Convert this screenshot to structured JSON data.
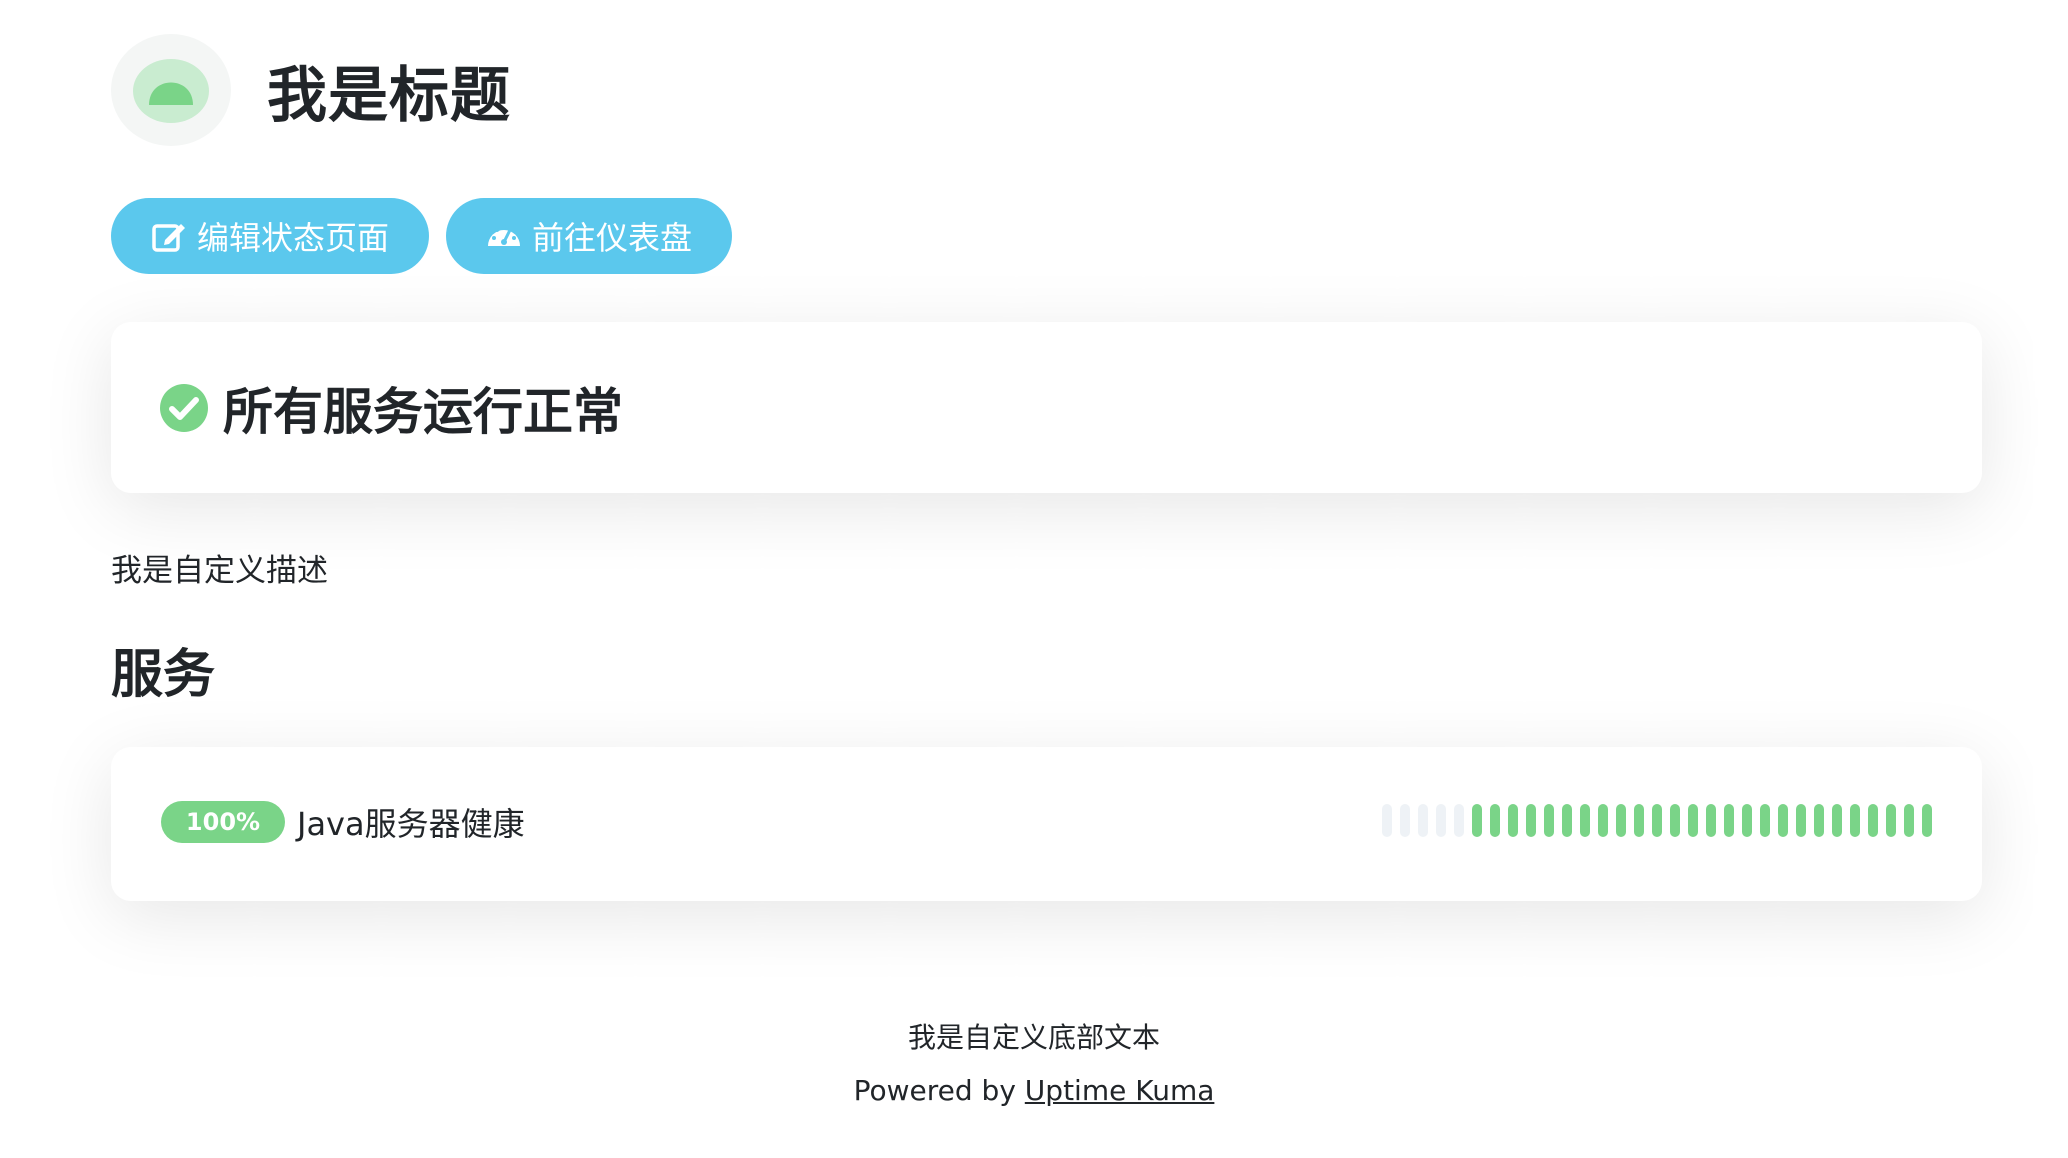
{
  "header": {
    "title": "我是标题",
    "logo_icon": "bulb-logo-icon"
  },
  "actions": {
    "edit_label": "编辑状态页面",
    "edit_icon": "edit-icon",
    "dashboard_label": "前往仪表盘",
    "dashboard_icon": "dashboard-icon"
  },
  "status": {
    "text": "所有服务运行正常",
    "icon": "check-circle-icon"
  },
  "description": "我是自定义描述",
  "services": {
    "heading": "服务",
    "items": [
      {
        "uptime": "100%",
        "name": "Java服务器健康",
        "heartbeats": {
          "empty": 5,
          "up": 26
        }
      }
    ]
  },
  "footer": {
    "text": "我是自定义底部文本",
    "powered_prefix": "Powered by ",
    "powered_link": "Uptime Kuma"
  },
  "colors": {
    "primary": "#5bc8ed",
    "success": "#7ad488",
    "empty": "#eef2f6",
    "text": "#212529"
  }
}
